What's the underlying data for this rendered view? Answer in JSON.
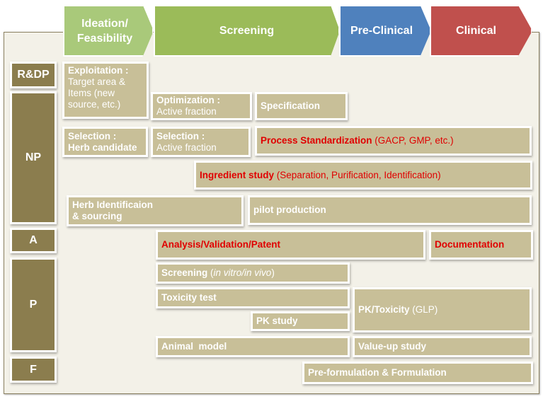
{
  "phases": [
    {
      "label": "Ideation/ Feasibility",
      "color": "#a9c97a"
    },
    {
      "label": "Screening",
      "color": "#9bbb59"
    },
    {
      "label": "Pre-Clinical",
      "color": "#4f81bd"
    },
    {
      "label": "Clinical",
      "color": "#c0504d"
    }
  ],
  "rows": [
    "R&DP",
    "NP",
    "A",
    "P",
    "F"
  ],
  "boxes": {
    "exploitation": {
      "bold": "Exploitation :",
      "normal": "Target area & Items (new source, etc.)"
    },
    "optimization": {
      "bold": "Optimization :",
      "normal": "Active fraction"
    },
    "specification": {
      "bold": "Specification"
    },
    "selection_herb": {
      "bold": "Selection :",
      "bold2": "Herb candidate"
    },
    "selection_active": {
      "bold": "Selection :",
      "normal": "Active fraction"
    },
    "process": {
      "bold": "Process Standardization",
      "normal": " (GACP, GMP, etc.)"
    },
    "ingredient": {
      "bold": "Ingredient study",
      "normal": " (Separation, Purification, Identification)"
    },
    "herb_ident": {
      "bold": "Herb Identificaion",
      "bold2": "& sourcing"
    },
    "pilot": {
      "bold": "pilot production"
    },
    "analysis": {
      "bold": "Analysis/Validation/Patent"
    },
    "documentation": {
      "bold": "Documentation"
    },
    "screening": {
      "bold": "Screening",
      "normal": " (",
      "italic": "in vitro/in vivo",
      "close": ")"
    },
    "toxicity": {
      "bold": "Toxicity test"
    },
    "pk_study": {
      "bold": "PK study"
    },
    "pk_toxicity": {
      "bold": "PK/Toxicity",
      "normal": " (GLP)"
    },
    "animal": {
      "bold": "Animal  model"
    },
    "value_up": {
      "bold": "Value-up study"
    },
    "formulation": {
      "bold": "Pre-formulation & Formulation"
    }
  },
  "colors": {
    "box": "#c8bf98",
    "label": "#8b7d4e",
    "highlight": "#e00000",
    "panel": "#f3f1e8"
  }
}
